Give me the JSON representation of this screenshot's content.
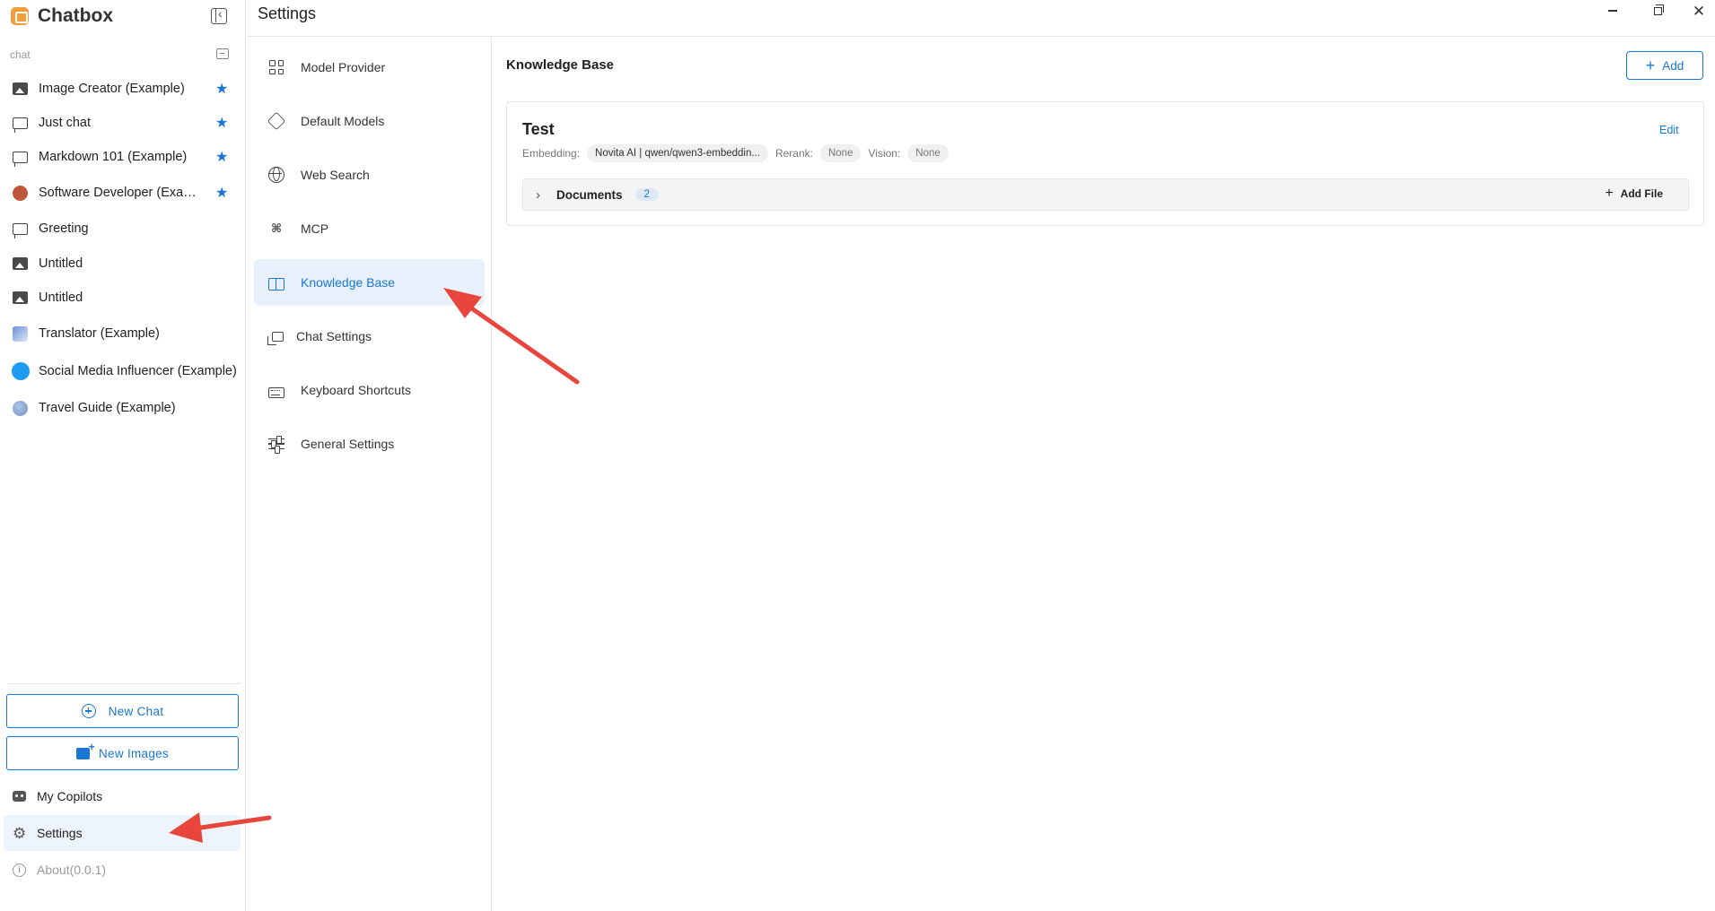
{
  "app": {
    "name": "Chatbox"
  },
  "sidebar": {
    "section_label": "chat",
    "sessions": [
      {
        "label": "Image Creator (Example)",
        "icon": "image-icon",
        "starred": true
      },
      {
        "label": "Just chat",
        "icon": "chat-bubble-icon",
        "starred": true
      },
      {
        "label": "Markdown 101 (Example)",
        "icon": "chat-bubble-icon",
        "starred": true
      },
      {
        "label": "Software Developer (Example)",
        "icon": "developer-avatar-icon",
        "starred": true
      },
      {
        "label": "Greeting",
        "icon": "chat-bubble-icon",
        "starred": false
      },
      {
        "label": "Untitled",
        "icon": "image-icon",
        "starred": false
      },
      {
        "label": "Untitled",
        "icon": "image-icon",
        "starred": false
      },
      {
        "label": "Translator (Example)",
        "icon": "translator-avatar-icon",
        "starred": false
      },
      {
        "label": "Social Media Influencer (Example)",
        "icon": "twitter-avatar-icon",
        "starred": false
      },
      {
        "label": "Travel Guide (Example)",
        "icon": "globe-avatar-icon",
        "starred": false
      }
    ],
    "new_chat_label": "New Chat",
    "new_images_label": "New Images",
    "my_copilots_label": "My Copilots",
    "settings_label": "Settings",
    "about_label": "About(0.0.1)"
  },
  "titlebar": {
    "title": "Settings"
  },
  "settings_nav": {
    "items": [
      {
        "label": "Model Provider",
        "icon": "grid-icon"
      },
      {
        "label": "Default Models",
        "icon": "cube-icon"
      },
      {
        "label": "Web Search",
        "icon": "globe-icon"
      },
      {
        "label": "MCP",
        "icon": "mcp-icon"
      },
      {
        "label": "Knowledge Base",
        "icon": "book-icon",
        "active": true
      },
      {
        "label": "Chat Settings",
        "icon": "chats-icon"
      },
      {
        "label": "Keyboard Shortcuts",
        "icon": "keyboard-icon"
      },
      {
        "label": "General Settings",
        "icon": "sliders-icon"
      }
    ]
  },
  "main": {
    "heading": "Knowledge Base",
    "add_label": "Add",
    "kb": {
      "name": "Test",
      "edit_label": "Edit",
      "embedding_label": "Embedding:",
      "embedding_value": "Novita AI | qwen/qwen3-embeddin...",
      "rerank_label": "Rerank:",
      "rerank_value": "None",
      "vision_label": "Vision:",
      "vision_value": "None",
      "documents_label": "Documents",
      "documents_count": "2",
      "add_file_label": "Add File"
    }
  },
  "colors": {
    "accent": "#1976d2",
    "active_bg": "#e8f1fb",
    "arrow": "#e8453c"
  }
}
